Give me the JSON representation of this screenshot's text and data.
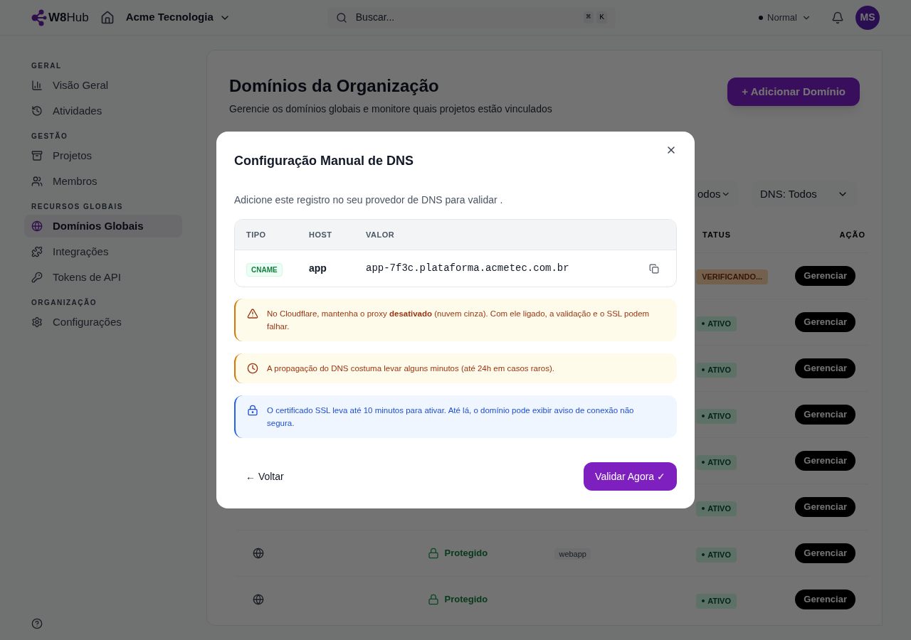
{
  "header": {
    "logo": "**W8**Hub",
    "org": "Acme Tecnologia",
    "search": {
      "placeholder": "Buscar...",
      "shortcut": [
        "⌘",
        "K"
      ]
    },
    "status": {
      "label": "Normal"
    },
    "avatar": "MS"
  },
  "sidebar": {
    "sections": [
      {
        "title": "GERAL",
        "items": [
          {
            "label": "Visão Geral",
            "selected": false
          },
          {
            "label": "Atividades",
            "selected": false
          }
        ]
      },
      {
        "title": "GESTÃO",
        "items": [
          {
            "label": "Projetos",
            "selected": false
          },
          {
            "label": "Membros",
            "selected": false
          }
        ]
      },
      {
        "title": "RECURSOS GLOBAIS",
        "items": [
          {
            "label": "Domínios Globais",
            "selected": true
          },
          {
            "label": "Integrações",
            "selected": false
          },
          {
            "label": "Tokens de API",
            "selected": false
          }
        ]
      },
      {
        "title": "ORGANIZAÇÃO",
        "items": [
          {
            "label": "Configurações",
            "selected": false
          }
        ]
      }
    ]
  },
  "page": {
    "title": "Domínios da Organização",
    "subtitle": "Gerencie os domínios globais e monitore quais projetos estão vinculados",
    "add_button": "+ Adicionar Domínio",
    "filters": [
      "odos",
      "DNS: Todos"
    ],
    "columns": [
      "TATUS",
      "AÇÃO"
    ],
    "rows": [
      {
        "status": {
          "label": "VERIFICANDO...",
          "kind": "verifying"
        },
        "action": "Gerenciar"
      },
      {
        "status": {
          "label": "ATIVO",
          "kind": "active"
        },
        "action": "Gerenciar"
      },
      {
        "status": {
          "label": "ATIVO",
          "kind": "active"
        },
        "action": "Gerenciar"
      },
      {
        "status": {
          "label": "ATIVO",
          "kind": "active"
        },
        "action": "Gerenciar"
      },
      {
        "status": {
          "label": "ATIVO",
          "kind": "active"
        },
        "action": "Gerenciar"
      },
      {
        "status": {
          "label": "ATIVO",
          "kind": "active"
        },
        "action": "Gerenciar"
      },
      {
        "ssl": "Protegido",
        "project": "webapp",
        "status": {
          "label": "ATIVO",
          "kind": "active"
        },
        "action": "Gerenciar"
      },
      {
        "ssl": "Protegido",
        "status": {
          "label": "ATIVO",
          "kind": "active"
        },
        "action": "Gerenciar"
      }
    ]
  },
  "modal": {
    "title": "Configuração Manual de DNS",
    "intro": "Adicione este registro no seu provedor de DNS para validar .",
    "record": {
      "columns": [
        "TIPO",
        "HOST",
        "VALOR"
      ],
      "type": "CNAME",
      "host": "app",
      "value": "app-7f3c.plataforma.acmetec.com.br"
    },
    "alerts": [
      {
        "kind": "warning",
        "text": "No Cloudflare, mantenha o proxy **desativado** (nuvem cinza). Com ele ligado, a validação e o SSL podem falhar."
      },
      {
        "kind": "time",
        "text": "A propagação do DNS costuma levar alguns minutos (até 24h em casos raros)."
      },
      {
        "kind": "info",
        "text": "O certificado SSL leva até 10 minutos para ativar. Até lá, o domínio pode exibir aviso de conexão não segura."
      }
    ],
    "back": "← Voltar",
    "confirm": "Validar Agora ✓"
  }
}
